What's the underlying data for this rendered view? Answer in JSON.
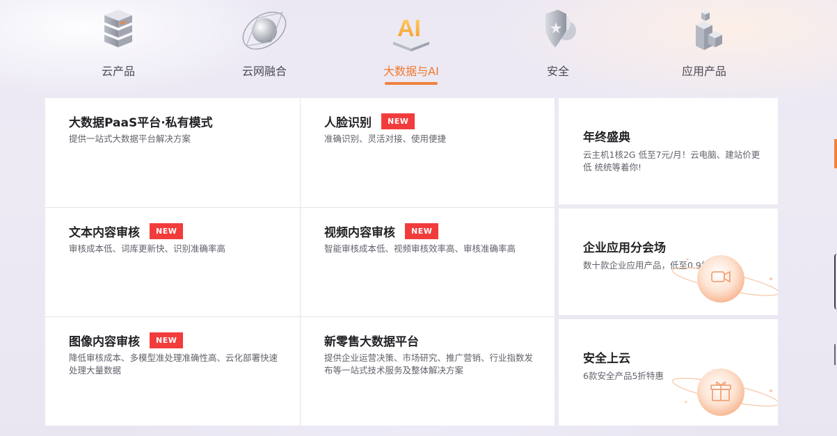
{
  "tabs": [
    {
      "label": "云产品",
      "icon": "server-stack-icon",
      "active": false
    },
    {
      "label": "云网融合",
      "icon": "network-globe-icon",
      "active": false
    },
    {
      "label": "大数据与AI",
      "icon": "ai-cube-icon",
      "active": true
    },
    {
      "label": "安全",
      "icon": "shield-cloud-icon",
      "active": false
    },
    {
      "label": "应用产品",
      "icon": "app-blocks-icon",
      "active": false
    }
  ],
  "products": [
    {
      "title": "大数据PaaS平台·私有模式",
      "desc": "提供一站式大数据平台解决方案",
      "badge": ""
    },
    {
      "title": "人脸识别",
      "desc": "准确识别、灵活对接、使用便捷",
      "badge": "NEW"
    },
    {
      "title": "文本内容审核",
      "desc": "审核成本低、词库更新快、识别准确率高",
      "badge": "NEW"
    },
    {
      "title": "视频内容审核",
      "desc": "智能审核成本低、视频审核效率高、审核准确率高",
      "badge": "NEW"
    },
    {
      "title": "图像内容审核",
      "desc": "降低审核成本、多模型准处理准确性高、云化部署快速处理大量数据",
      "badge": "NEW"
    },
    {
      "title": "新零售大数据平台",
      "desc": "提供企业运营决策、市场研究、推广营销、行业指数发布等一站式技术服务及整体解决方案",
      "badge": ""
    }
  ],
  "promos": [
    {
      "title": "年终盛典",
      "desc": "云主机1核2G 低至7元/月！云电脑、建站价更低 统统等着你!",
      "icon": ""
    },
    {
      "title": "企业应用分会场",
      "desc": "数十款企业应用产品，低至0.9折!",
      "icon": "video-camera-icon"
    },
    {
      "title": "安全上云",
      "desc": "6款安全产品5折特惠",
      "icon": "gift-box-icon"
    }
  ],
  "colors": {
    "accent": "#f0823c",
    "badge": "#f23c3c"
  }
}
